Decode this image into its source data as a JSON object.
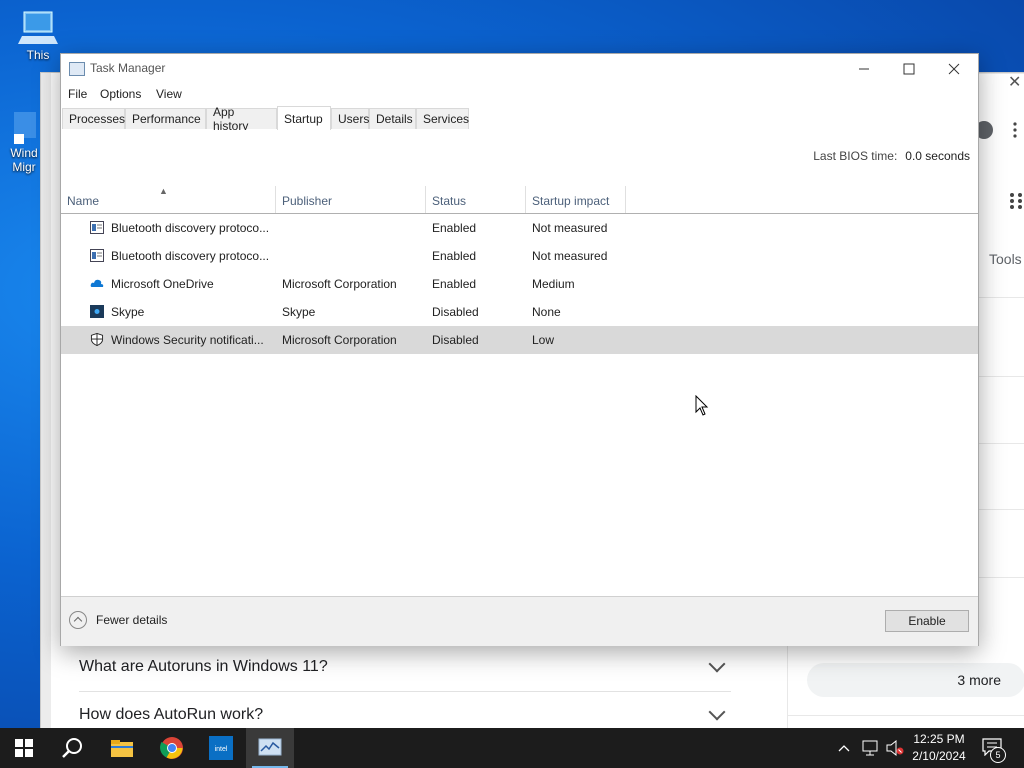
{
  "desktop": {
    "icons": [
      {
        "label": "This",
        "icon": "computer-icon"
      },
      {
        "label": "Wind\nMigr",
        "icon": "windows-migration-icon"
      }
    ]
  },
  "browser": {
    "faq": [
      {
        "question": "What are Autoruns in Windows 11?"
      },
      {
        "question": "How does AutoRun work?"
      }
    ],
    "more_label": "3 more",
    "tools_label": "Tools"
  },
  "task_manager": {
    "title": "Task Manager",
    "menu": [
      "File",
      "Options",
      "View"
    ],
    "tabs": [
      "Processes",
      "Performance",
      "App history",
      "Startup",
      "Users",
      "Details",
      "Services"
    ],
    "active_tab": "Startup",
    "bios_label": "Last BIOS time:",
    "bios_value": "0.0 seconds",
    "columns": [
      "Name",
      "Publisher",
      "Status",
      "Startup impact"
    ],
    "rows": [
      {
        "icon": "bluetooth-app-icon",
        "name": "Bluetooth discovery protoco...",
        "publisher": "",
        "status": "Enabled",
        "impact": "Not measured",
        "selected": false
      },
      {
        "icon": "bluetooth-app-icon",
        "name": "Bluetooth discovery protoco...",
        "publisher": "",
        "status": "Enabled",
        "impact": "Not measured",
        "selected": false
      },
      {
        "icon": "onedrive-icon",
        "name": "Microsoft OneDrive",
        "publisher": "Microsoft Corporation",
        "status": "Enabled",
        "impact": "Medium",
        "selected": false
      },
      {
        "icon": "skype-icon",
        "name": "Skype",
        "publisher": "Skype",
        "status": "Disabled",
        "impact": "None",
        "selected": false
      },
      {
        "icon": "windows-security-icon",
        "name": "Windows Security notificati...",
        "publisher": "Microsoft Corporation",
        "status": "Disabled",
        "impact": "Low",
        "selected": true
      }
    ],
    "fewer_details": "Fewer details",
    "enable_button": "Enable"
  },
  "taskbar": {
    "apps": [
      "start-icon",
      "search-icon",
      "file-explorer-icon",
      "chrome-icon",
      "intel-icon",
      "task-manager-icon"
    ],
    "active_app": "task-manager-icon",
    "time": "12:25 PM",
    "date": "2/10/2024",
    "notification_count": "5"
  },
  "colors": {
    "desktop_blue": "#0b63d0",
    "selection_gray": "#d9d9d9",
    "taskbar": "#1c1c1c"
  }
}
